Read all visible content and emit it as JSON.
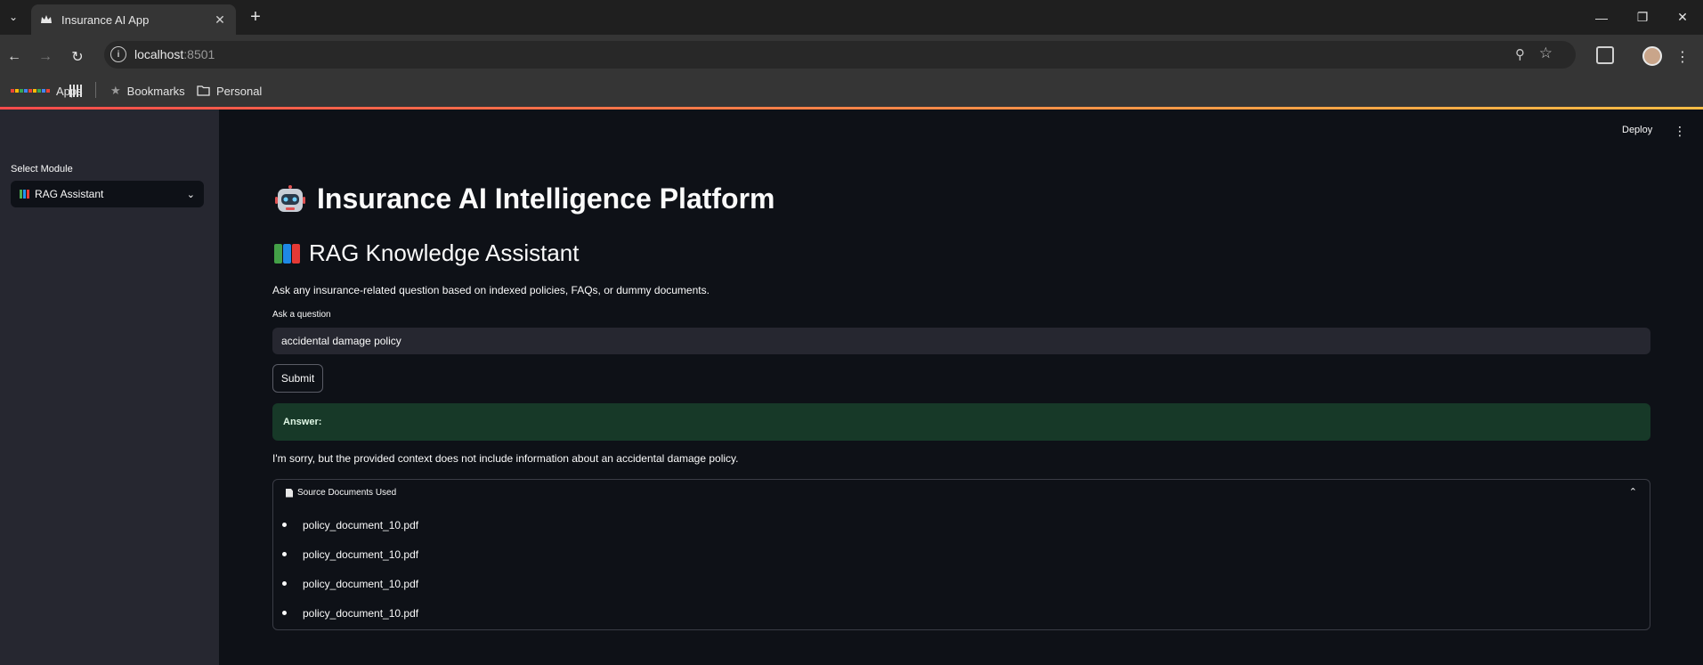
{
  "browser": {
    "tab_title": "Insurance AI App",
    "url_host": "localhost",
    "url_port": ":8501",
    "bookmarks": [
      {
        "label": "Apps",
        "icon": "apps-grid-icon"
      },
      {
        "label": "Bookmarks",
        "icon": "star-icon"
      },
      {
        "label": "Personal",
        "icon": "folder-icon"
      }
    ]
  },
  "sidebar": {
    "label": "Select Module",
    "selected": "RAG Assistant",
    "selected_icon": "books-emoji"
  },
  "header": {
    "deploy_label": "Deploy"
  },
  "main": {
    "title": "Insurance AI Intelligence Platform",
    "title_icon": "robot-emoji",
    "subtitle": "RAG Knowledge Assistant",
    "subtitle_icon": "books-emoji",
    "description": "Ask any insurance-related question based on indexed policies, FAQs, or dummy documents.",
    "question_label": "Ask a question",
    "question_value": "accidental damage policy",
    "submit_label": "Submit",
    "answer_label": "Answer:",
    "answer_text": "I'm sorry, but the provided context does not include information about an accidental damage policy.",
    "sources_title": "Source Documents Used",
    "sources": [
      "policy_document_10.pdf",
      "policy_document_10.pdf",
      "policy_document_10.pdf",
      "policy_document_10.pdf"
    ]
  },
  "colors": {
    "background": "#0e1117",
    "sidebar": "#262730",
    "success_bg": "#173928",
    "accent_gradient_start": "#ff4b4b",
    "accent_gradient_end": "#ffbd45"
  }
}
